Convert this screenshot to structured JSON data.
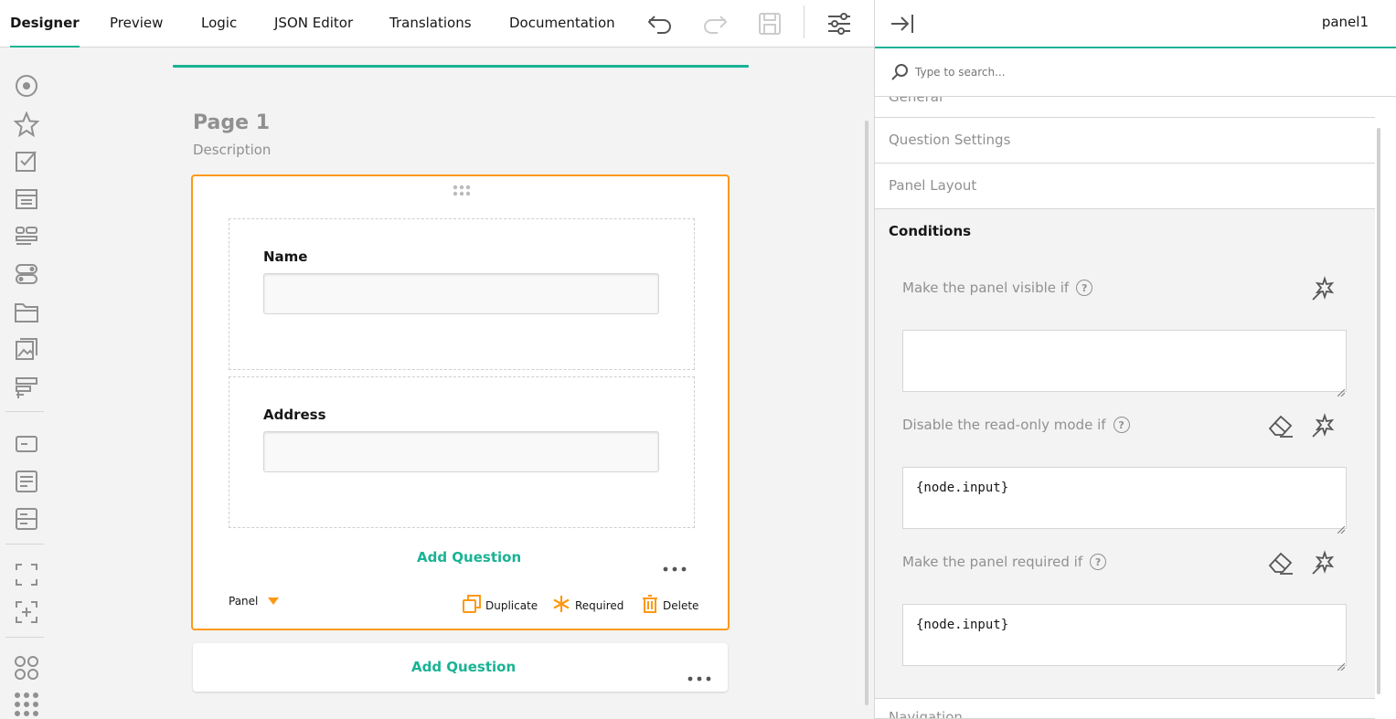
{
  "tabs": [
    {
      "label": "Designer",
      "active": true
    },
    {
      "label": "Preview"
    },
    {
      "label": "Logic"
    },
    {
      "label": "JSON Editor"
    },
    {
      "label": "Translations"
    },
    {
      "label": "Documentation"
    }
  ],
  "toolbar": {
    "undo_icon": "undo-icon",
    "redo_icon": "redo-icon",
    "save_icon": "save-icon",
    "settings_icon": "settings-sliders-icon"
  },
  "toolbox_icons": [
    "radiogroup-icon",
    "rating-icon",
    "checkbox-icon",
    "dropdown-icon",
    "tagbox-icon",
    "boolean-icon",
    "file-icon",
    "image-picker-icon",
    "ranking-icon",
    "text-input-icon",
    "comment-icon",
    "multiple-text-icon",
    "panel-icon",
    "panel-dynamic-icon",
    "matrix-icon",
    "matrix-dropdown-icon"
  ],
  "page": {
    "title": "Page 1",
    "description": "Description"
  },
  "panel": {
    "questions": [
      {
        "label": "Name",
        "value": ""
      },
      {
        "label": "Address",
        "value": ""
      }
    ],
    "add_question": "Add Question",
    "type_label": "Panel",
    "actions": {
      "duplicate": "Duplicate",
      "required": "Required",
      "delete": "Delete"
    }
  },
  "page_add_question": "Add Question",
  "props": {
    "title": "panel1",
    "search_placeholder": "Type to search...",
    "sections": {
      "general": "General",
      "question_settings": "Question Settings",
      "panel_layout": "Panel Layout",
      "conditions": "Conditions",
      "navigation": "Navigation"
    },
    "conditions": {
      "visible_if": {
        "label": "Make the panel visible if",
        "value": ""
      },
      "enable_if": {
        "label": "Disable the read-only mode if",
        "value": "{node.input}"
      },
      "required_if": {
        "label": "Make the panel required if",
        "value": "{node.input}"
      }
    }
  },
  "colors": {
    "accent": "#19b394",
    "selection": "#ff9814",
    "icon": "#909090"
  }
}
